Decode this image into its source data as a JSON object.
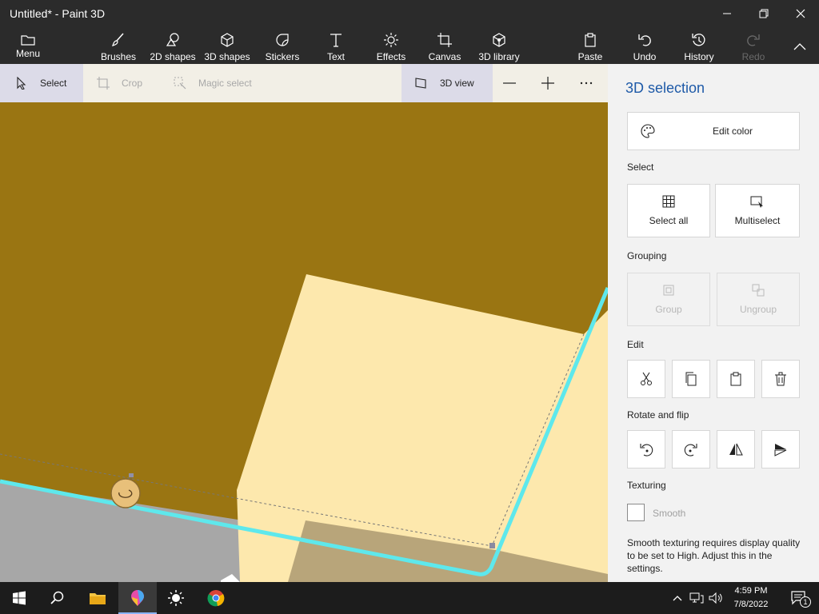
{
  "window": {
    "title": "Untitled* - Paint 3D",
    "minimize_icon": "minimize-icon",
    "restore_icon": "restore-icon",
    "close_icon": "close-icon"
  },
  "ribbon": {
    "menu": "Menu",
    "brushes": "Brushes",
    "shapes2d": "2D shapes",
    "shapes3d": "3D shapes",
    "stickers": "Stickers",
    "text": "Text",
    "effects": "Effects",
    "canvas": "Canvas",
    "library3d": "3D library",
    "paste": "Paste",
    "undo": "Undo",
    "history": "History",
    "redo": "Redo"
  },
  "toolbar": {
    "select": "Select",
    "crop": "Crop",
    "magic_select": "Magic select",
    "view3d": "3D view"
  },
  "panel": {
    "title": "3D selection",
    "edit_color": "Edit color",
    "select_label": "Select",
    "select_all": "Select all",
    "multiselect": "Multiselect",
    "grouping_label": "Grouping",
    "group": "Group",
    "ungroup": "Ungroup",
    "edit_label": "Edit",
    "rotate_label": "Rotate and flip",
    "texturing_label": "Texturing",
    "smooth": "Smooth",
    "smooth_note": "Smooth texturing requires display quality to be set to High. Adjust this in the settings."
  },
  "taskbar": {
    "time": "4:59 PM",
    "date": "7/8/2022",
    "notification_count": "1"
  },
  "colors": {
    "canvas_brown": "#9a7512",
    "object_cream": "#fde8ad",
    "selection_cyan": "#5ee8ec",
    "accent_blue": "#1e5aa8"
  }
}
